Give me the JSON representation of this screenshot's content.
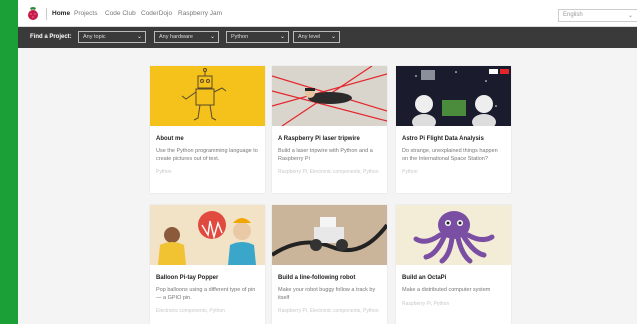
{
  "nav": {
    "items": [
      {
        "label": "Home",
        "active": true
      },
      {
        "label": "Projects",
        "active": false
      },
      {
        "label": "Code Club",
        "active": false
      },
      {
        "label": "CoderDojo",
        "active": false
      },
      {
        "label": "Raspberry Jam",
        "active": false
      }
    ],
    "language": "English"
  },
  "filters": {
    "label": "Find a Project:",
    "items": [
      {
        "value": "Any topic"
      },
      {
        "value": "Any hardware"
      },
      {
        "value": "Python"
      },
      {
        "value": "Any level"
      }
    ]
  },
  "cards": [
    {
      "title": "About me",
      "desc": "Use the Python programming language to create pictures out of text.",
      "meta": "Python",
      "image": "robot-drawing"
    },
    {
      "title": "A Raspberry Pi laser tripwire",
      "desc": "Build a laser tripwire with Python and a Raspberry Pi",
      "meta": "Raspberry Pi, Electronic components, Python",
      "image": "laser-heist"
    },
    {
      "title": "Astro Pi Flight Data Analysis",
      "desc": "Do strange, unexplained things happen on the International Space Station?",
      "meta": "Python",
      "image": "astronauts"
    },
    {
      "title": "Balloon Pi-tay Popper",
      "desc": "Pop balloons using a different type of pin — a GPIO pin.",
      "meta": "Electronic components, Python",
      "image": "balloon-popper"
    },
    {
      "title": "Build a line-following robot",
      "desc": "Make your robot buggy follow a track by itself",
      "meta": "Raspberry Pi, Electronic components, Python",
      "image": "line-robot"
    },
    {
      "title": "Build an OctaPi",
      "desc": "Make a distributed computer system",
      "meta": "Raspberry Pi, Python",
      "image": "octopus"
    }
  ],
  "colors": {
    "side_bar": "#1aa037",
    "filter_bar": "#3a3a3a"
  }
}
